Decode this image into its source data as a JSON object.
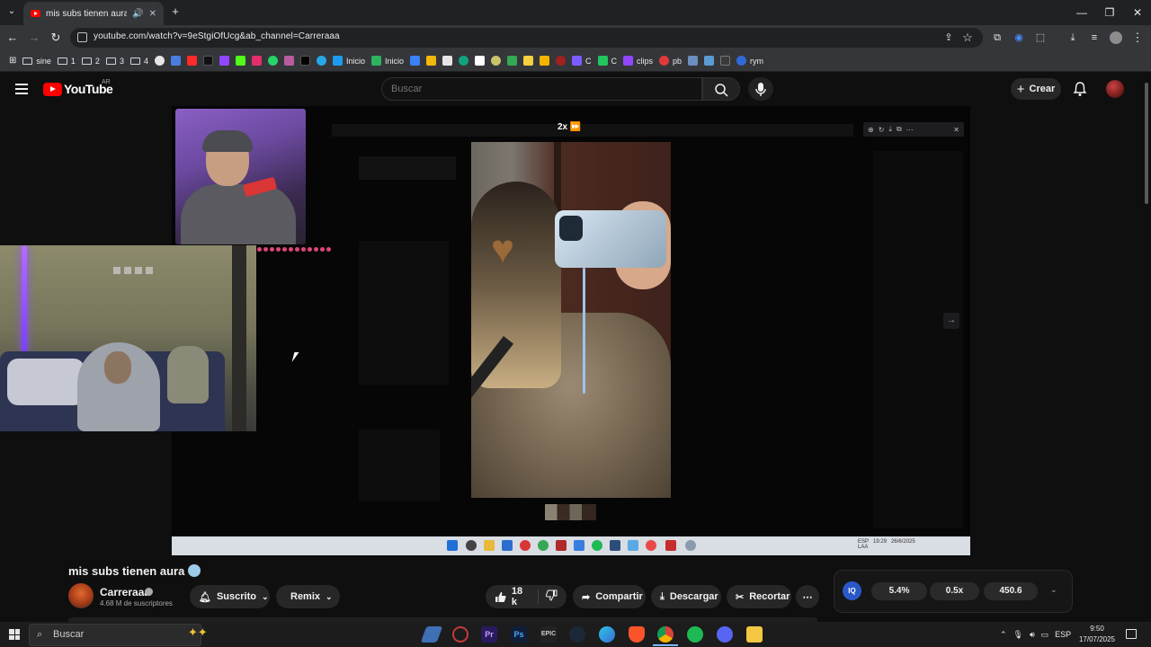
{
  "browser": {
    "tab_title": "mis subs tienen aura 🥶 - Y",
    "url": "youtube.com/watch?v=9eStgiOfUcg&ab_channel=Carreraaa",
    "window_controls": [
      "—",
      "❐",
      "✕"
    ],
    "bookmarks": [
      {
        "label": "sine",
        "type": "folder"
      },
      {
        "label": "1",
        "type": "folder"
      },
      {
        "label": "2",
        "type": "folder"
      },
      {
        "label": "3",
        "type": "folder"
      },
      {
        "label": "4",
        "type": "folder"
      },
      {
        "label": "Inicio",
        "type": "link",
        "color": "#1d9bf0"
      },
      {
        "label": "Inicio",
        "type": "link",
        "color": "#2db35e"
      },
      {
        "label": "C",
        "type": "link",
        "color": "#7d5cff"
      },
      {
        "label": "C",
        "type": "link",
        "color": "#23c55e"
      },
      {
        "label": "clips",
        "type": "link",
        "color": "#9147ff"
      },
      {
        "label": "pb",
        "type": "link",
        "color": "#e03a3a"
      },
      {
        "label": "rym",
        "type": "link",
        "color": "#2f6bd8"
      }
    ]
  },
  "youtube": {
    "logo_text": "YouTube",
    "country": "AR",
    "search_placeholder": "Buscar",
    "create_label": "Crear"
  },
  "player": {
    "speed_label": "2x ⏩"
  },
  "video": {
    "title": "mis subs tienen aura",
    "channel_name": "Carreraaa",
    "subscribers": "4.68 M de suscriptores",
    "subscribe_label": "Suscrito",
    "remix_label": "Remix",
    "likes": "18 k",
    "share_label": "Compartir",
    "download_label": "Descargar",
    "clip_label": "Recortar"
  },
  "extension_widget": {
    "logo": "IQ",
    "values": [
      "5.4%",
      "0.5x",
      "450.6"
    ]
  },
  "inner_taskbar": {
    "lang": "ESP\nLAA",
    "time": "19:29",
    "date": "26/6/2025"
  },
  "taskbar": {
    "search_placeholder": "Buscar",
    "lang": "ESP",
    "time": "9:50",
    "date": "17/07/2025"
  },
  "colors": {
    "youtube_red": "#ff0000",
    "background": "#0f0f0f",
    "chrome_toolbar": "#35363a"
  }
}
